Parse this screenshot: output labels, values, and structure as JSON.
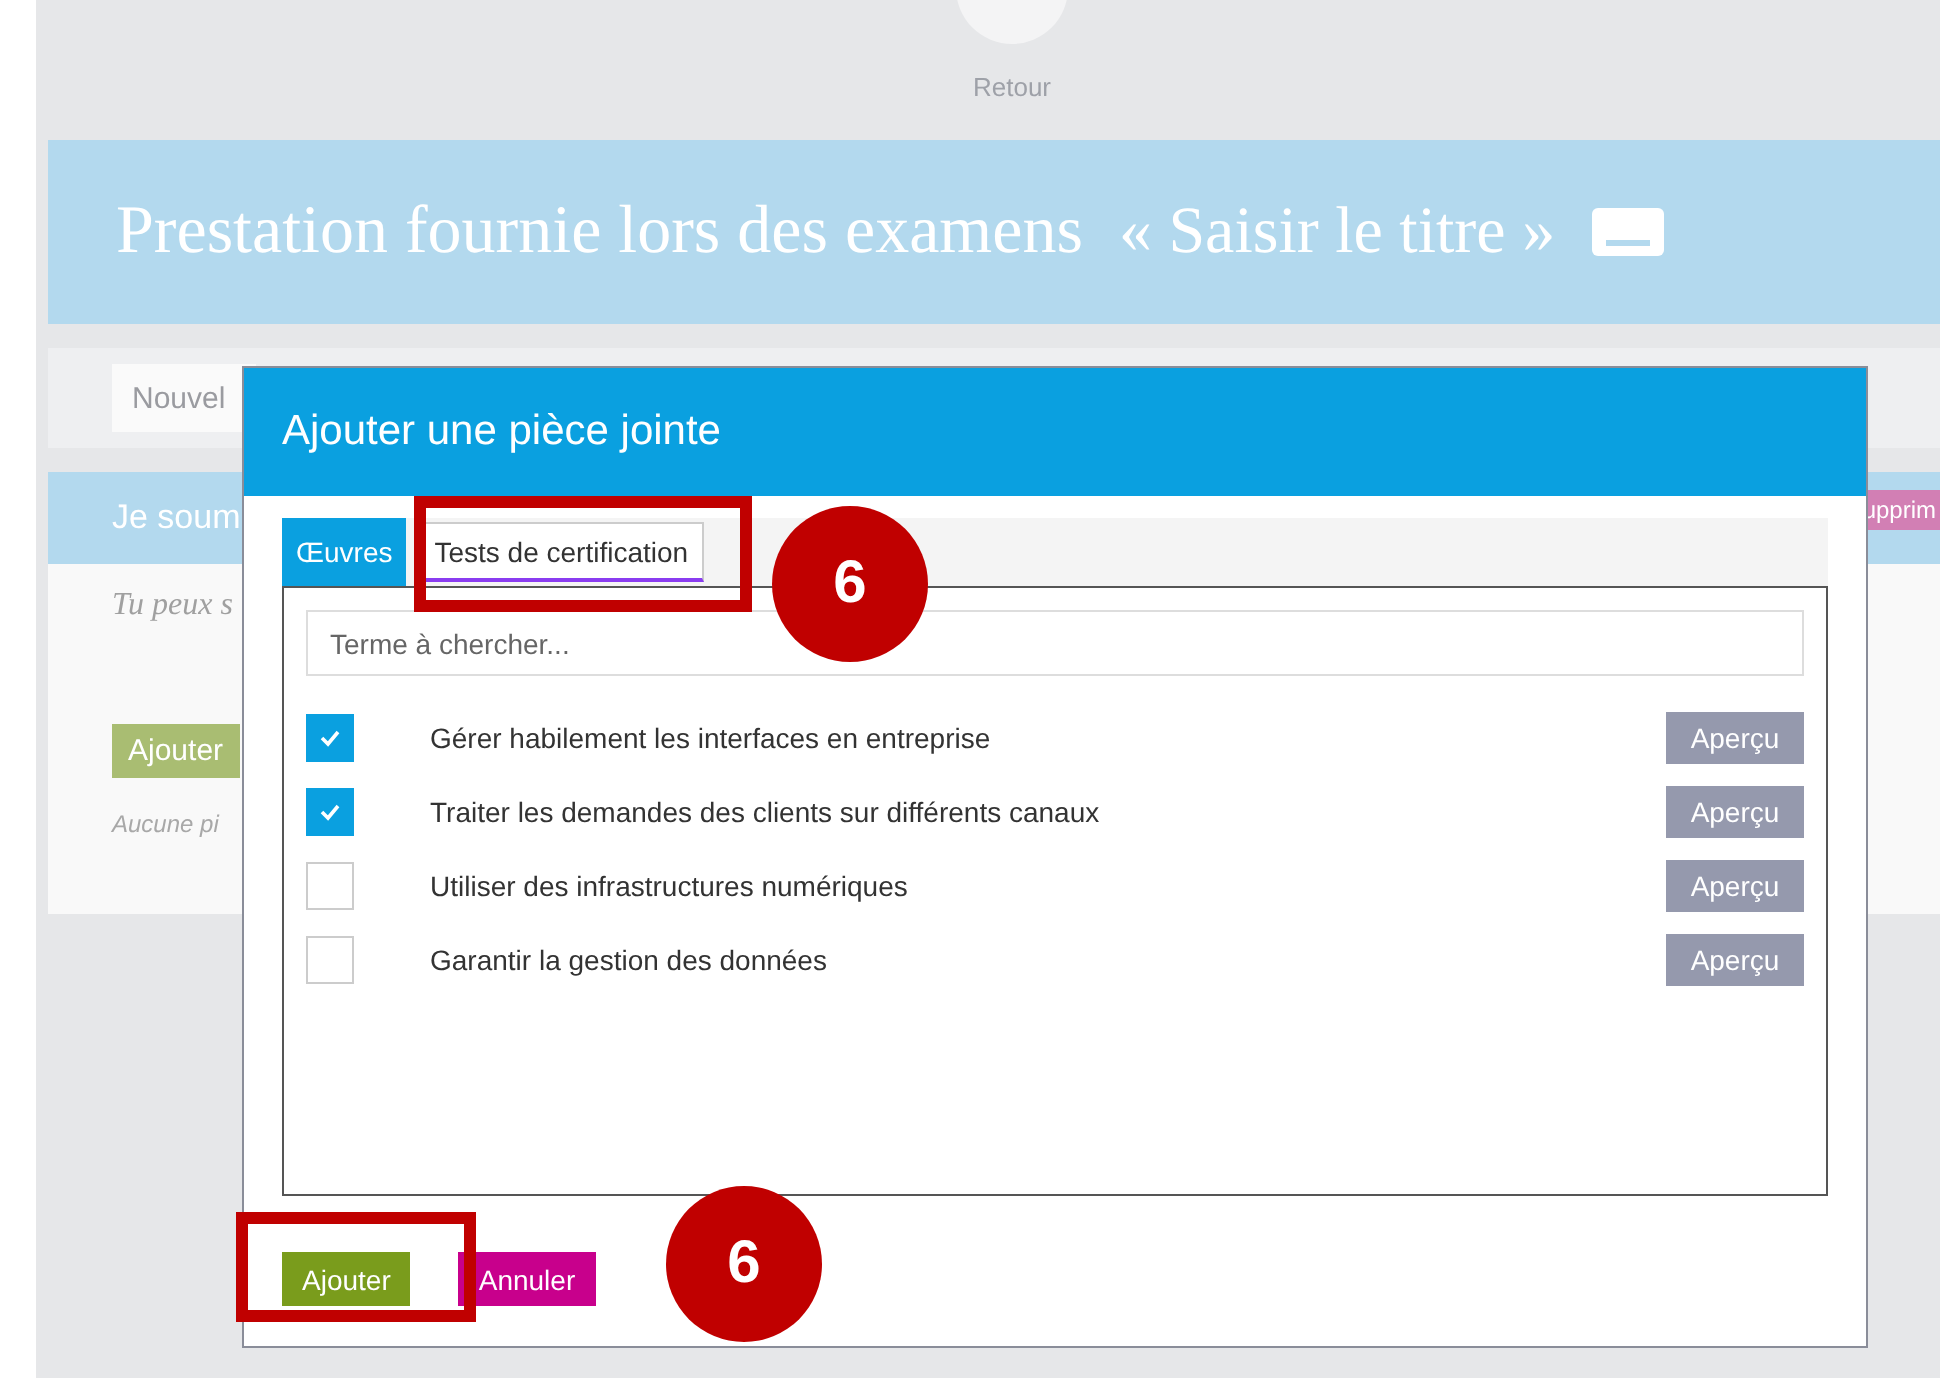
{
  "background": {
    "back_label": "Retour",
    "title": "Prestation fournie lors des examens",
    "title_hint": "« Saisir le titre »",
    "new_field": {
      "placeholder": "Nouvel"
    },
    "section_title": "Je soum",
    "section_badge": "upprim",
    "hint": "Tu peux s",
    "add_button": "Ajouter",
    "empty_note": "Aucune pi"
  },
  "dialog": {
    "title": "Ajouter une pièce jointe",
    "tabs": [
      {
        "label": "Œuvres",
        "selected": false
      },
      {
        "label": "Tests de certification",
        "selected": true
      }
    ],
    "search": {
      "placeholder": "Terme à chercher..."
    },
    "items": [
      {
        "label": "Gérer habilement les interfaces en entreprise",
        "checked": true,
        "preview": "Aperçu"
      },
      {
        "label": "Traiter les demandes des clients sur différents canaux",
        "checked": true,
        "preview": "Aperçu"
      },
      {
        "label": "Utiliser des infrastructures numériques",
        "checked": false,
        "preview": "Aperçu"
      },
      {
        "label": "Garantir la gestion des données",
        "checked": false,
        "preview": "Aperçu"
      }
    ],
    "buttons": [
      {
        "label": "Ajouter",
        "kind": "confirm"
      },
      {
        "label": "Annuler",
        "kind": "cancel"
      }
    ]
  },
  "annotations": [
    {
      "label": "6"
    },
    {
      "label": "6"
    }
  ]
}
